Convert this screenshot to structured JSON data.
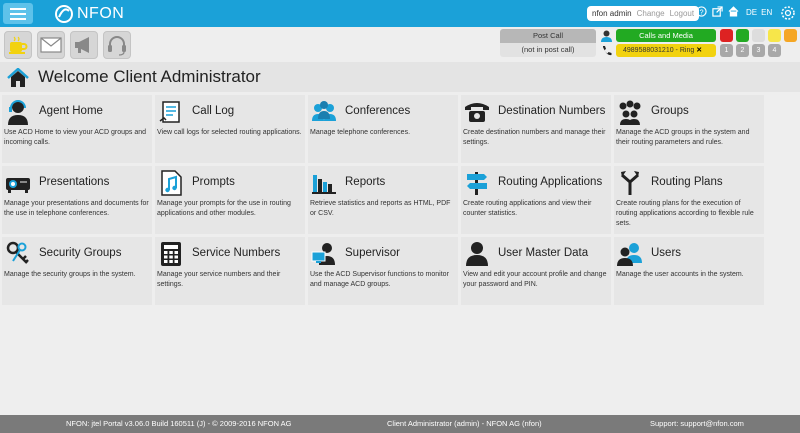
{
  "header": {
    "logo_text": "NFON",
    "user_name": "nfon admin",
    "change_label": "Change",
    "logout_label": "Logout",
    "lang_de": "DE",
    "lang_en": "EN",
    "bar_color": "#1ba1d8"
  },
  "call_status": {
    "post_call": "Post Call",
    "post_call_state": "(not in post call)",
    "calls_and_media": "Calls and Media",
    "ringing_number": "4989588031210 - Ring",
    "status_colors": [
      "#dd2222",
      "#22aa22",
      "#dddddd",
      "#f7e64a",
      "#f5a623"
    ],
    "lines": [
      "1",
      "2",
      "3",
      "4"
    ]
  },
  "page": {
    "title": "Welcome Client Administrator"
  },
  "tiles": [
    {
      "title": "Agent Home",
      "desc": "Use ACD Home to view your ACD groups and incoming calls.",
      "icon": "agent-icon"
    },
    {
      "title": "Call Log",
      "desc": "View call logs for selected routing applications.",
      "icon": "call-log-icon"
    },
    {
      "title": "Conferences",
      "desc": "Manage telephone conferences.",
      "icon": "conferences-icon"
    },
    {
      "title": "Destination Numbers",
      "desc": "Create destination numbers and manage their settings.",
      "icon": "telephone-icon"
    },
    {
      "title": "Groups",
      "desc": "Manage the ACD groups in the system and their routing parameters and rules.",
      "icon": "groups-icon"
    },
    {
      "title": "Presentations",
      "desc": "Manage your presentations and documents for the use in telephone conferences.",
      "icon": "projector-icon"
    },
    {
      "title": "Prompts",
      "desc": "Manage your prompts for the use in routing applications and other modules.",
      "icon": "music-file-icon"
    },
    {
      "title": "Reports",
      "desc": "Retrieve statistics and reports as HTML, PDF or CSV.",
      "icon": "bar-chart-icon"
    },
    {
      "title": "Routing Applications",
      "desc": "Create routing applications and view their counter statistics.",
      "icon": "signpost-icon"
    },
    {
      "title": "Routing Plans",
      "desc": "Create routing plans for the execution of routing applications according to flexible rule sets.",
      "icon": "routing-arrows-icon"
    },
    {
      "title": "Security Groups",
      "desc": "Manage the security groups in the system.",
      "icon": "keys-icon"
    },
    {
      "title": "Service Numbers",
      "desc": "Manage your service numbers and their settings.",
      "icon": "keypad-icon"
    },
    {
      "title": "Supervisor",
      "desc": "Use the ACD Supervisor functions to monitor and manage ACD groups.",
      "icon": "supervisor-icon"
    },
    {
      "title": "User Master Data",
      "desc": "View and edit your account profile and change your password and PIN.",
      "icon": "user-icon"
    },
    {
      "title": "Users",
      "desc": "Manage the user accounts in the system.",
      "icon": "users-icon"
    }
  ],
  "footer": {
    "version": "NFON: jtel Portal v3.06.0 Build 160511 (J) - © 2009-2016 NFON AG",
    "client": "Client Administrator (admin) - NFON AG (nfon)",
    "support": "Support: support@nfon.com"
  }
}
